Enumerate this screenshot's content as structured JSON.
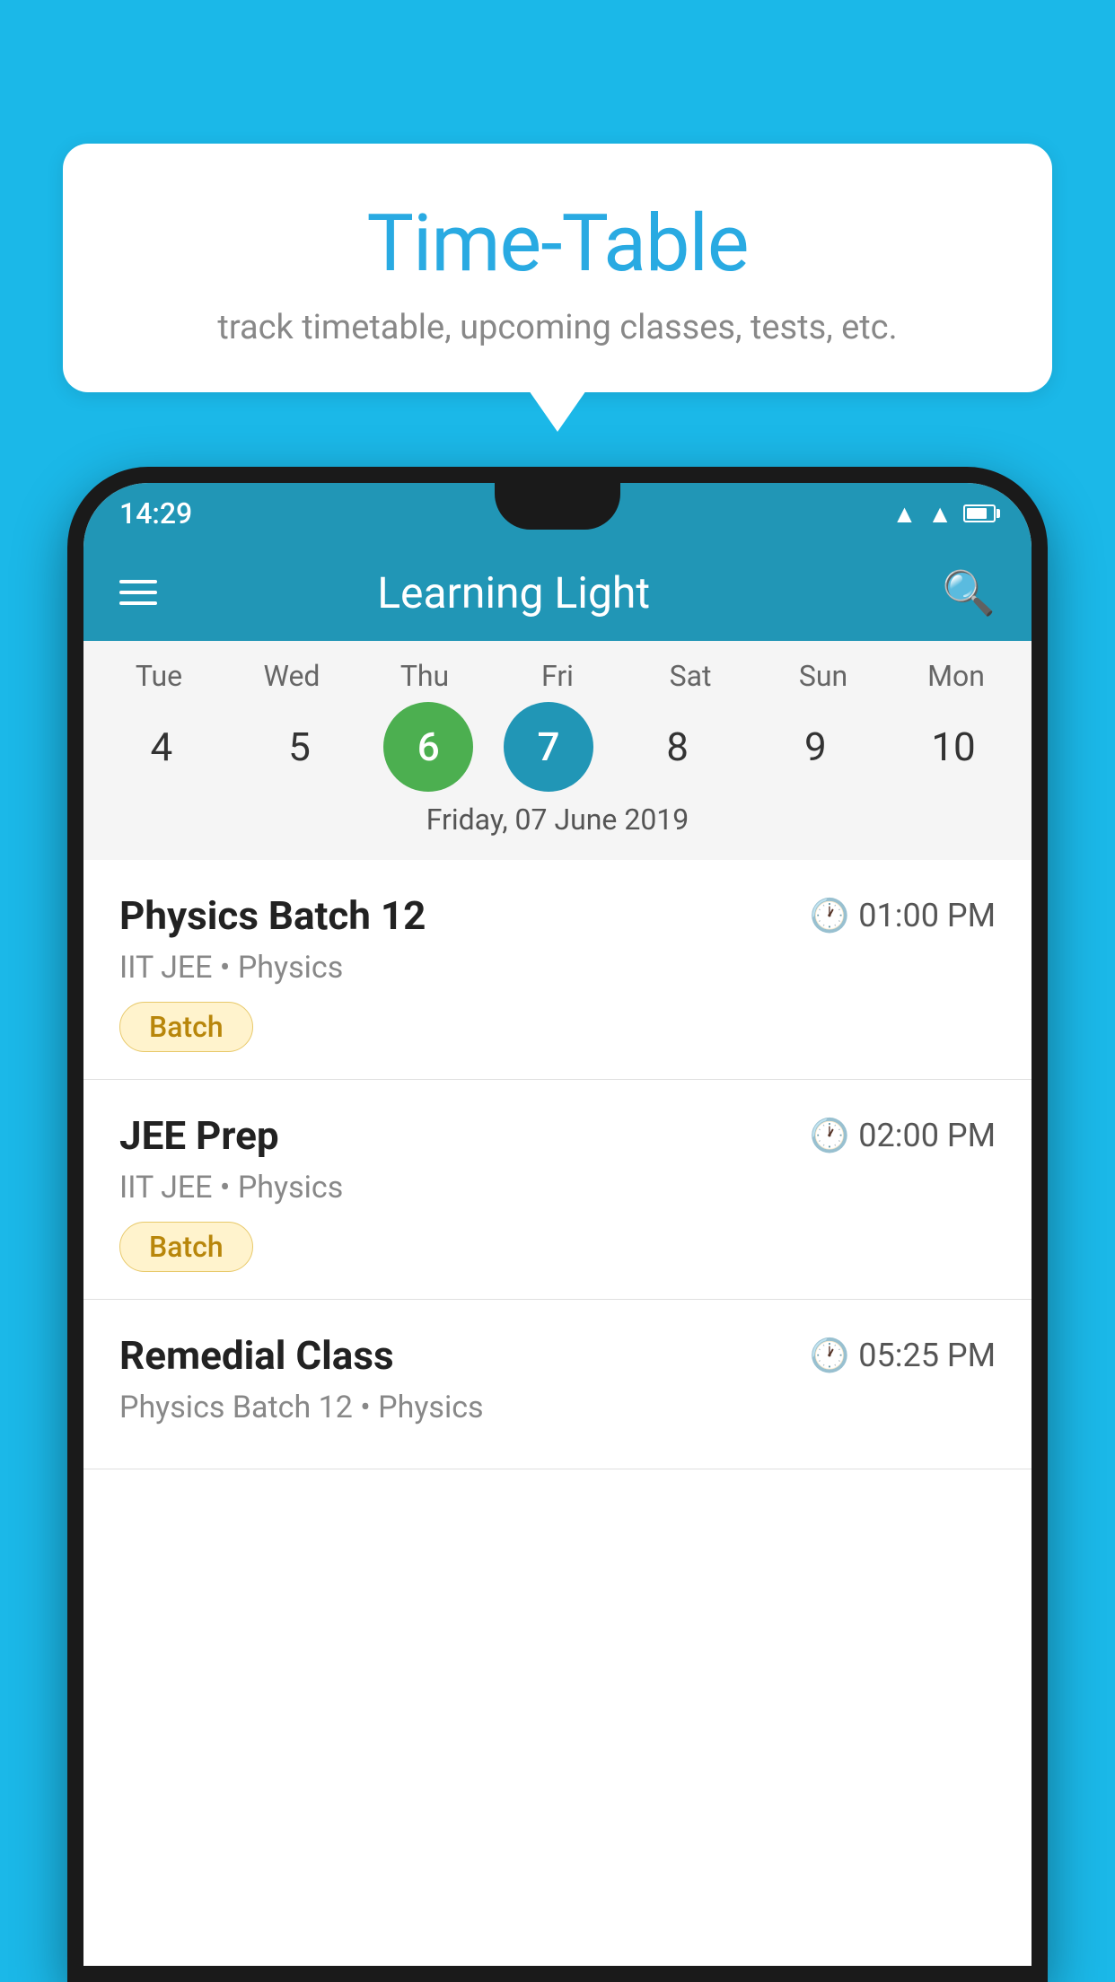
{
  "background_color": "#1bb8e8",
  "speech_bubble": {
    "title": "Time-Table",
    "subtitle": "track timetable, upcoming classes, tests, etc."
  },
  "phone": {
    "status_bar": {
      "time": "14:29"
    },
    "app_bar": {
      "title": "Learning Light"
    },
    "calendar": {
      "days": [
        {
          "label": "Tue",
          "number": "4"
        },
        {
          "label": "Wed",
          "number": "5"
        },
        {
          "label": "Thu",
          "number": "6",
          "state": "today"
        },
        {
          "label": "Fri",
          "number": "7",
          "state": "selected"
        },
        {
          "label": "Sat",
          "number": "8"
        },
        {
          "label": "Sun",
          "number": "9"
        },
        {
          "label": "Mon",
          "number": "10"
        }
      ],
      "selected_date_label": "Friday, 07 June 2019"
    },
    "schedule": [
      {
        "title": "Physics Batch 12",
        "time": "01:00 PM",
        "subtitle": "IIT JEE • Physics",
        "badge": "Batch"
      },
      {
        "title": "JEE Prep",
        "time": "02:00 PM",
        "subtitle": "IIT JEE • Physics",
        "badge": "Batch"
      },
      {
        "title": "Remedial Class",
        "time": "05:25 PM",
        "subtitle": "Physics Batch 12 • Physics",
        "badge": null
      }
    ]
  }
}
